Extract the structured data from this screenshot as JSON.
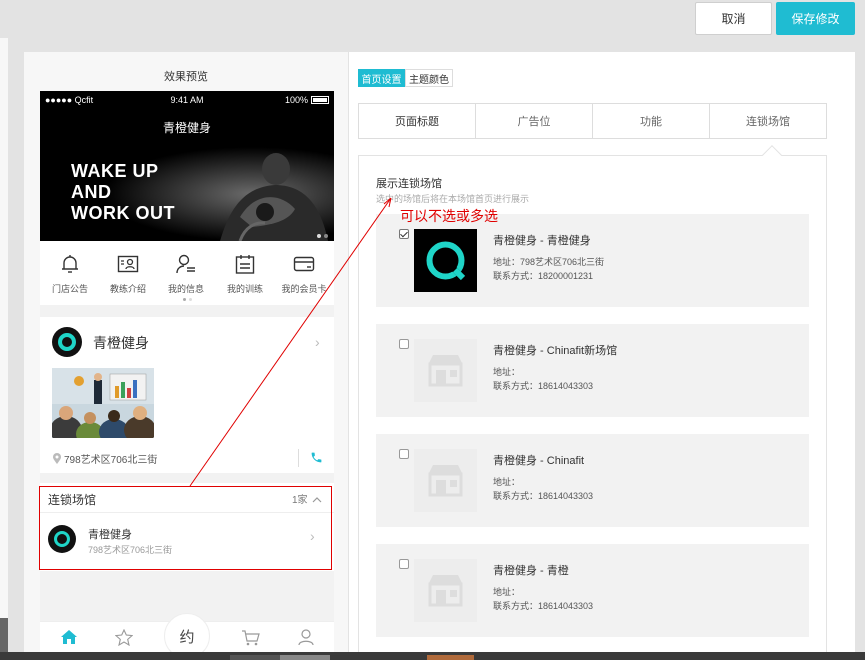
{
  "toolbar": {
    "cancel_label": "取消",
    "save_label": "保存修改"
  },
  "preview": {
    "title": "效果预览",
    "status": {
      "carrier": "●●●●● Qcfit",
      "time": "9:41 AM",
      "battery": "100%"
    },
    "nav_title": "青橙健身",
    "banner": {
      "line1": "WAKE UP",
      "line2": "AND",
      "line3": "WORK OUT"
    },
    "quick_nav": [
      {
        "label": "门店公告",
        "icon": "bell-icon"
      },
      {
        "label": "教练介绍",
        "icon": "id-card-icon"
      },
      {
        "label": "我的信息",
        "icon": "user-list-icon"
      },
      {
        "label": "我的训练",
        "icon": "calendar-icon"
      },
      {
        "label": "我的会员卡",
        "icon": "card-icon"
      }
    ],
    "store": {
      "name": "青橙健身",
      "address": "798艺术区706北三街"
    },
    "chain": {
      "title": "连锁场馆",
      "count": "1家",
      "item_name": "青橙健身",
      "item_address": "798艺术区706北三街"
    },
    "tabbar": {
      "center_label": "约",
      "icons": [
        "home-icon",
        "star-icon",
        "cart-icon",
        "person-icon"
      ]
    }
  },
  "settings": {
    "subtabs": [
      "首页设置",
      "主题颜色"
    ],
    "tabs": [
      "页面标题",
      "广告位",
      "功能",
      "连锁场馆"
    ],
    "section_title": "展示连锁场馆",
    "section_hint": "选中的场馆后将在本场馆首页进行展示",
    "annotation": "可以不选或多选",
    "venues": [
      {
        "name": "青橙健身 - 青橙健身",
        "address": "地址：798艺术区706北三街",
        "phone": "联系方式：18200001231",
        "checked": true,
        "has_logo": true
      },
      {
        "name": "青橙健身 - Chinafit新场馆",
        "address": "地址：",
        "phone": "联系方式：18614043303",
        "checked": false,
        "has_logo": false
      },
      {
        "name": "青橙健身 - Chinafit",
        "address": "地址：",
        "phone": "联系方式：18614043303",
        "checked": false,
        "has_logo": false
      },
      {
        "name": "青橙健身 - 青橙",
        "address": "地址：",
        "phone": "联系方式：18614043303",
        "checked": false,
        "has_logo": false
      }
    ]
  },
  "colors": {
    "accent": "#1fbcd2",
    "annotation_red": "#e00000",
    "logo_ring": "#1fd5c8"
  }
}
